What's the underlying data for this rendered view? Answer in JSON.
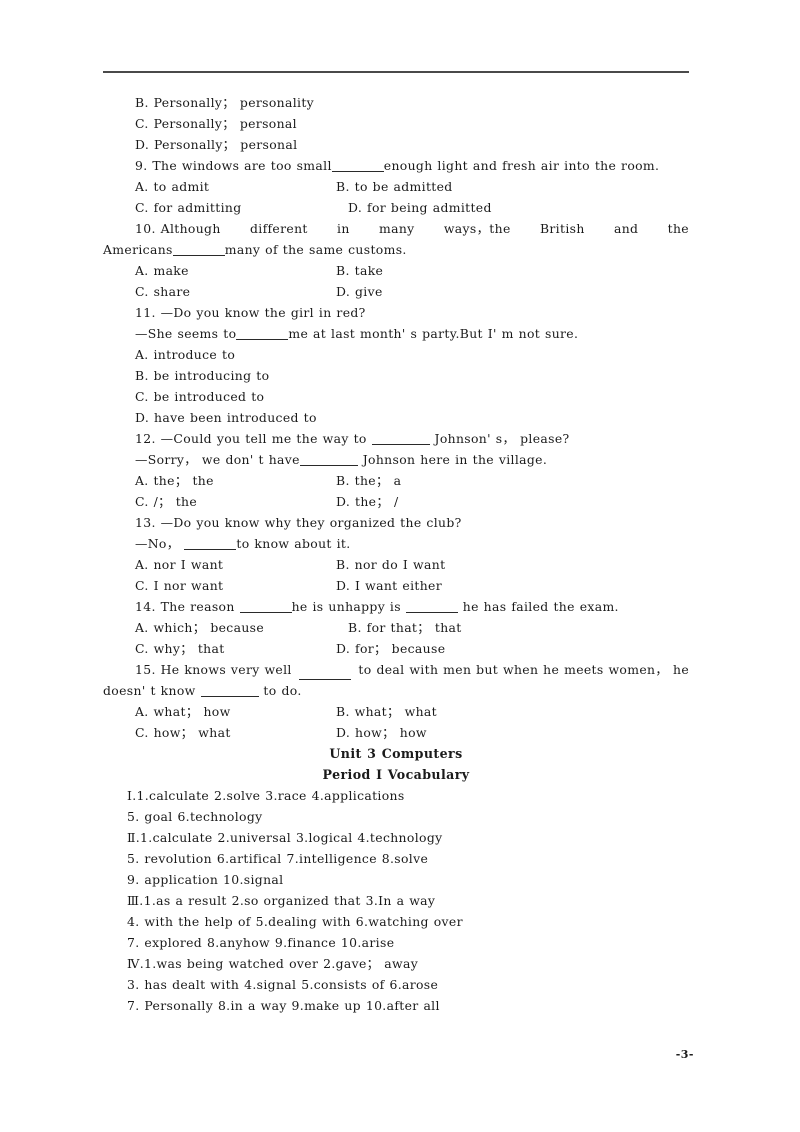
{
  "document": {
    "page_number": "-3-"
  },
  "questions": [
    {
      "id": "q8-options",
      "options": [
        "B. Personally； personality",
        "C. Personally； personal",
        "D. Personally； personal"
      ]
    },
    {
      "id": "q9",
      "stem": "9. The windows are too small",
      "stem_tail": "enough light and fresh air into the room.",
      "opt_a": "A. to admit",
      "opt_b": "B. to be admitted",
      "opt_c": "C. for admitting",
      "opt_d": "D. for being admitted"
    },
    {
      "id": "q10",
      "stem_words": [
        "10. Although",
        "different",
        "in",
        "many",
        "ways，the",
        "British",
        "and",
        "the"
      ],
      "stem_line2_head": "Americans",
      "stem_line2_tail": "many of the same customs.",
      "opt_a": "A. make",
      "opt_b": "B. take",
      "opt_c": "C. share",
      "opt_d": "D. give"
    },
    {
      "id": "q11",
      "stem": "11. —Do you know the girl in red?",
      "stem2_head": "—She seems to",
      "stem2_tail": "me at last month' s party.But I' m not sure.",
      "opt_a": "A. introduce to",
      "opt_b": "B. be introducing to",
      "opt_c": "C. be introduced to",
      "opt_d": "D. have been introduced to"
    },
    {
      "id": "q12",
      "stem_head": "12. —Could you tell me the way to ",
      "stem_tail": " Johnson' s， please?",
      "stem2_head": "—Sorry， we don' t have",
      "stem2_tail": " Johnson here in the village.",
      "opt_a": "A. the； the",
      "opt_b": "B. the； a",
      "opt_c": "C. /； the",
      "opt_d": "D. the； /"
    },
    {
      "id": "q13",
      "stem": "13. —Do you know why they organized the club?",
      "stem2_head": "—No， ",
      "stem2_tail": "to know about it.",
      "opt_a": "A. nor I want",
      "opt_b": "B. nor do I want",
      "opt_c": "C. I nor want",
      "opt_d": "D. I want either"
    },
    {
      "id": "q14",
      "stem_head": "14. The reason ",
      "stem_mid": "he is unhappy is ",
      "stem_tail": " he has failed the exam.",
      "opt_a": "A. which； because",
      "opt_b": "B. for that； that",
      "opt_c": "C. why； that",
      "opt_d": "D. for； because"
    },
    {
      "id": "q15",
      "stem_words": [
        "15. He knows very well",
        "to deal with men but when he meets women， he"
      ],
      "stem_line2_head": "doesn' t know ",
      "stem_line2_tail": " to do.",
      "opt_a": "A. what； how",
      "opt_b": "B. what； what",
      "opt_c": "C. how； what",
      "opt_d": "D. how； how"
    }
  ],
  "unit": {
    "title": "Unit 3  Computers",
    "period": "Period Ⅰ  Vocabulary"
  },
  "answer_key": [
    {
      "marker": "Ⅰ",
      "lines": [
        "Ⅰ.1.calculate  2.solve  3.race  4.applications",
        "5. goal  6.technology"
      ]
    },
    {
      "marker": "Ⅱ",
      "lines": [
        "Ⅱ.1.calculate  2.universal  3.logical  4.technology",
        "5. revolution  6.artifical  7.intelligence  8.solve",
        "9. application  10.signal"
      ]
    },
    {
      "marker": "Ⅲ",
      "lines": [
        "Ⅲ.1.as a result  2.so organized that  3.In a way",
        "4. with the help of  5.dealing with  6.watching over",
        "7. explored  8.anyhow  9.finance  10.arise"
      ]
    },
    {
      "marker": "Ⅳ",
      "lines": [
        "Ⅳ.1.was being watched over  2.gave； away",
        "3. has dealt with  4.signal  5.consists of  6.arose",
        "7. Personally  8.in a way  9.make up  10.after all"
      ]
    }
  ]
}
